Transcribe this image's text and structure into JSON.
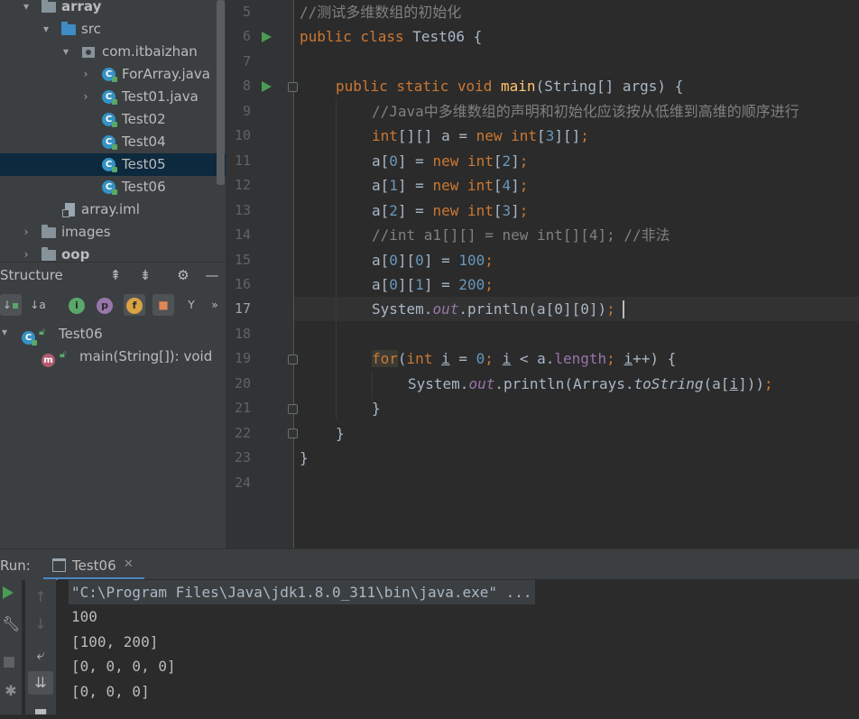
{
  "project_tree": {
    "items": [
      {
        "label": "array",
        "bold": true
      },
      {
        "label": "src"
      },
      {
        "label": "com.itbaizhan"
      },
      {
        "label": "ForArray.java"
      },
      {
        "label": "Test01.java"
      },
      {
        "label": "Test02"
      },
      {
        "label": "Test04"
      },
      {
        "label": "Test05"
      },
      {
        "label": "Test06"
      },
      {
        "label": "array.iml"
      },
      {
        "label": "images"
      },
      {
        "label": "oop",
        "bold": true
      }
    ],
    "selected": "Test05"
  },
  "structure_panel": {
    "title": "Structure",
    "class_node": "Test06",
    "method_node": "main(String[]): void"
  },
  "editor": {
    "line_numbers": [
      "5",
      "6",
      "7",
      "8",
      "9",
      "10",
      "11",
      "12",
      "13",
      "14",
      "15",
      "16",
      "17",
      "18",
      "19",
      "20",
      "21",
      "22",
      "23",
      "24"
    ],
    "current_line": "17",
    "code": {
      "l5": "//测试多维数组的初始化",
      "l6_kw": "public class",
      "l6_name": " Test06 {",
      "l8_kw": "public static void",
      "l8_fn": "main",
      "l8_rest": "(String[] args) {",
      "l9": "//Java中多维数组的声明和初始化应该按从低维到高维的顺序进行",
      "l10_int": "int",
      "l10_a": "[][] a = ",
      "l10_new": "new",
      "l10_int2": " int",
      "l10_open": "[",
      "l10_num": "3",
      "l10_close": "][]",
      "l10_semi": ";",
      "l11_idx": "0",
      "l11_size": "2",
      "l12_idx": "1",
      "l12_size": "4",
      "l13_idx": "2",
      "l13_size": "3",
      "l14": "//int a1[][] = new int[][4]; //非法",
      "l15_idx2": "0",
      "l15_val": "100",
      "l16_idx2": "1",
      "l16_val": "200",
      "l17_sys": "System.",
      "l17_out": "out",
      "l17_rest": ".println(a[0][0])",
      "l19_for": "for",
      "l19_int": "int",
      "l19_var": "i",
      "l19_eq": " = ",
      "l19_zero": "0",
      "l19_lt": " < a.",
      "l19_len": "length",
      "l19_pp": "++) {",
      "l20_sys": "System.",
      "l20_out": "out",
      "l20_mid": ".println(Arrays.",
      "l20_ts": "toString",
      "l20_rest": "(a[",
      "l20_var": "i",
      "l20_end": "]))",
      "l21": "}",
      "l22": "}",
      "l23": "}"
    }
  },
  "run_panel": {
    "label": "Run:",
    "tab_label": "Test06",
    "output": [
      "\"C:\\Program Files\\Java\\jdk1.8.0_311\\bin\\java.exe\" ...",
      "100",
      "[100, 200]",
      "[0, 0, 0, 0]",
      "[0, 0, 0]"
    ]
  },
  "colors": {
    "keyword": "#cc7832",
    "number": "#6897bb",
    "comment": "#808080",
    "function": "#ffc66d",
    "static_field": "#9876aa",
    "run_green": "#499c54"
  }
}
